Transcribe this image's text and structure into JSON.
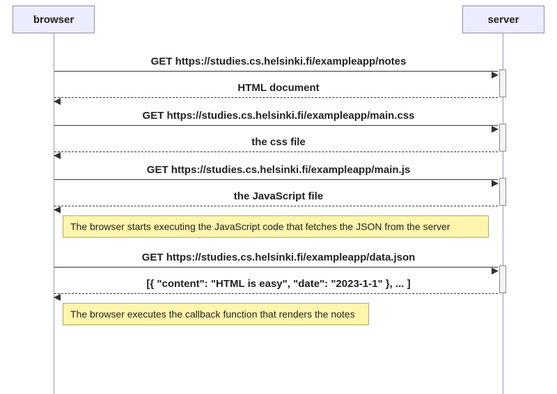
{
  "actors": {
    "left": "browser",
    "right": "server"
  },
  "messages": {
    "m1": "GET https://studies.cs.helsinki.fi/exampleapp/notes",
    "r1": "HTML document",
    "m2": "GET https://studies.cs.helsinki.fi/exampleapp/main.css",
    "r2": "the css file",
    "m3": "GET https://studies.cs.helsinki.fi/exampleapp/main.js",
    "r3": "the JavaScript file",
    "note1": "The browser starts executing the JavaScript code that fetches the JSON from the server",
    "m4": "GET https://studies.cs.helsinki.fi/exampleapp/data.json",
    "r4": "[{ \"content\": \"HTML is easy\", \"date\": \"2023-1-1\" }, ... ]",
    "note2": "The browser executes the callback function that renders the notes"
  }
}
